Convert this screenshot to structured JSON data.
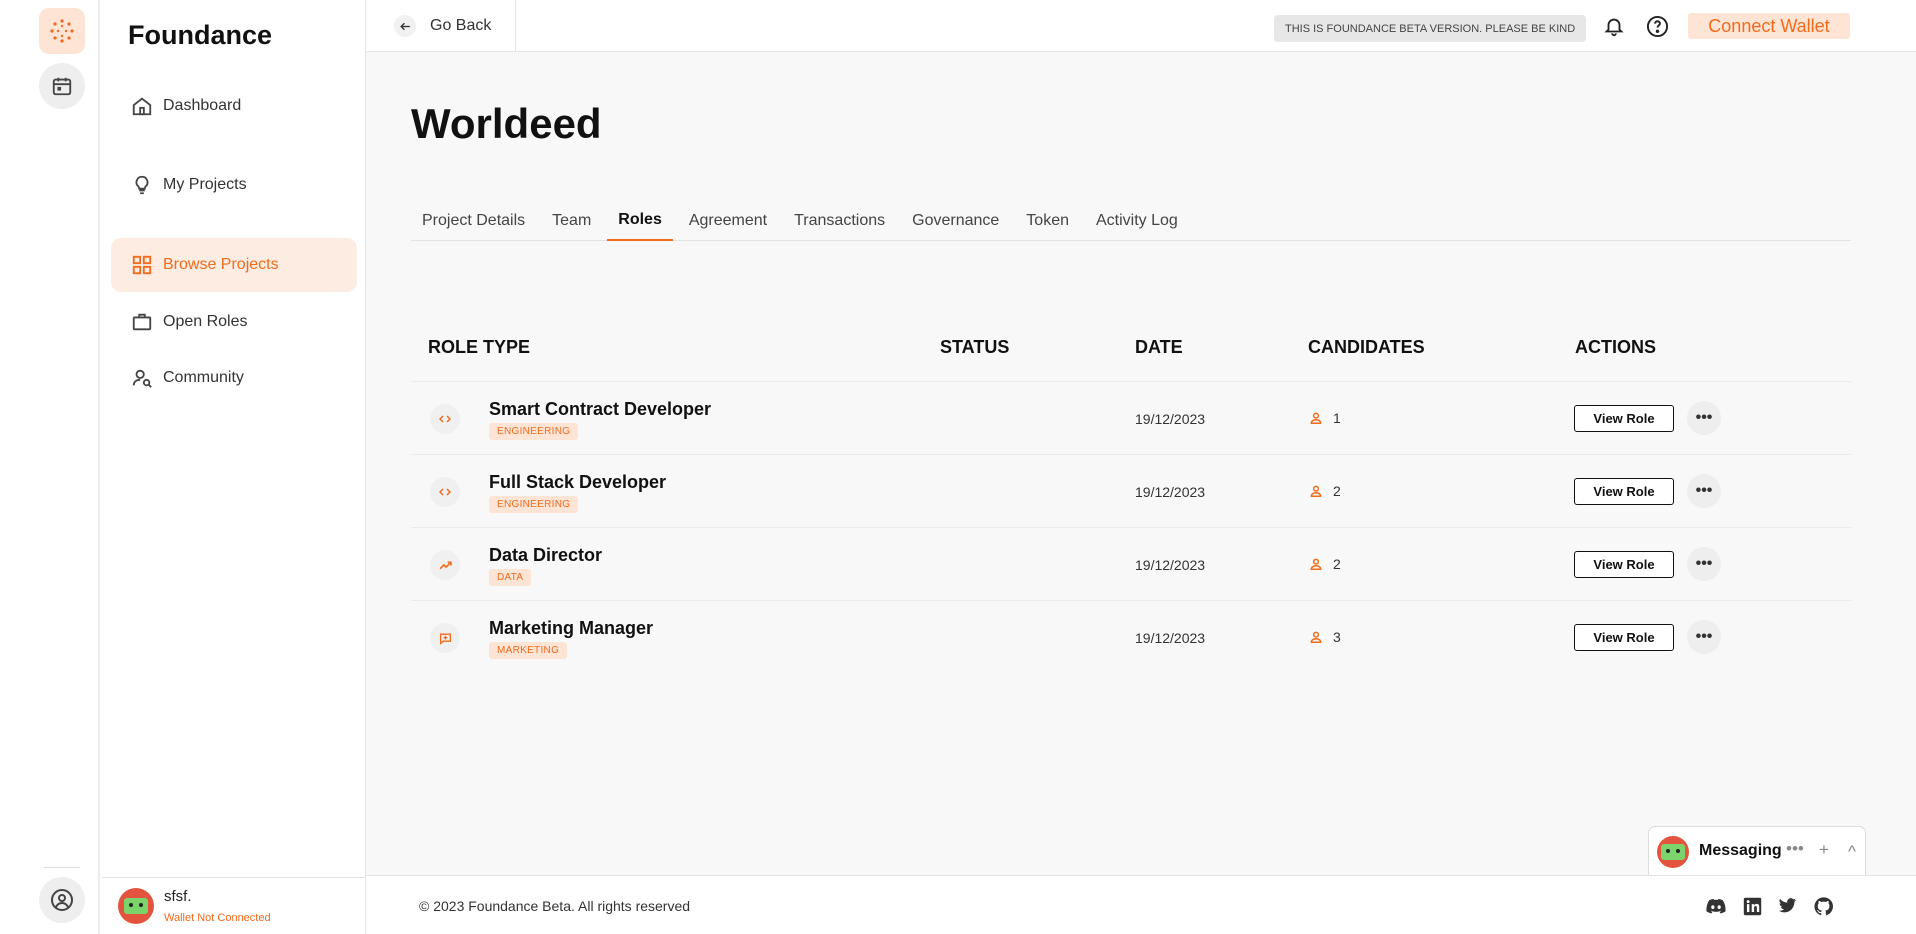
{
  "app": {
    "brand": "Foundance"
  },
  "sidebar": {
    "items": [
      {
        "label": "Dashboard",
        "icon": "home-icon"
      },
      {
        "label": "My Projects",
        "icon": "lightbulb-icon"
      },
      {
        "label": "Browse Projects",
        "icon": "grid-icon",
        "active": true
      },
      {
        "label": "Open Roles",
        "icon": "briefcase-icon"
      },
      {
        "label": "Community",
        "icon": "user-search-icon"
      }
    ],
    "user": {
      "name": "sfsf.",
      "status": "Wallet Not Connected"
    }
  },
  "topbar": {
    "back_label": "Go Back",
    "beta_notice": "THIS IS FOUNDANCE BETA VERSION. PLEASE BE KIND",
    "connect_label": "Connect Wallet"
  },
  "page": {
    "title": "Worldeed",
    "tabs": [
      "Project Details",
      "Team",
      "Roles",
      "Agreement",
      "Transactions",
      "Governance",
      "Token",
      "Activity Log"
    ],
    "active_tab": "Roles"
  },
  "table": {
    "headers": {
      "role_type": "ROLE TYPE",
      "status": "STATUS",
      "date": "DATE",
      "candidates": "CANDIDATES",
      "actions": "ACTIONS"
    },
    "view_label": "View Role",
    "more_label": "•••",
    "rows": [
      {
        "title": "Smart Contract Developer",
        "tag": "ENGINEERING",
        "icon": "code-icon",
        "status": "",
        "date": "19/12/2023",
        "candidates": "1"
      },
      {
        "title": "Full Stack Developer",
        "tag": "ENGINEERING",
        "icon": "code-icon",
        "status": "",
        "date": "19/12/2023",
        "candidates": "2"
      },
      {
        "title": "Data Director",
        "tag": "DATA",
        "icon": "trend-icon",
        "status": "",
        "date": "19/12/2023",
        "candidates": "2"
      },
      {
        "title": "Marketing Manager",
        "tag": "MARKETING",
        "icon": "chat-plus-icon",
        "status": "",
        "date": "19/12/2023",
        "candidates": "3"
      }
    ]
  },
  "footer": {
    "copyright": "© 2023 Foundance Beta. All rights reserved"
  },
  "messaging": {
    "label": "Messaging",
    "more": "•••",
    "add": "+",
    "collapse": "^"
  },
  "colors": {
    "accent": "#f26b1d",
    "accent_bg": "#fde4d5",
    "page_bg": "#f8f8f8"
  }
}
